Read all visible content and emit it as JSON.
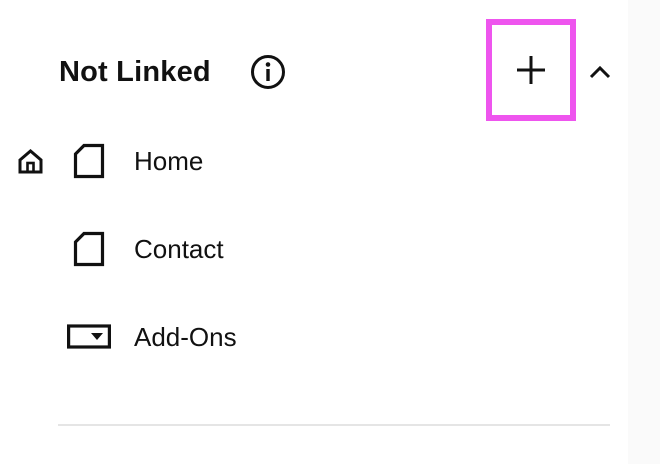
{
  "section": {
    "title": "Not Linked",
    "info_icon": "info-circle-icon",
    "add_icon": "plus-icon",
    "collapse_icon": "chevron-up-icon"
  },
  "pages": [
    {
      "label": "Home",
      "icon": "page-icon",
      "is_homepage": true,
      "homepage_icon": "home-icon"
    },
    {
      "label": "Contact",
      "icon": "page-icon",
      "is_homepage": false
    },
    {
      "label": "Add-Ons",
      "icon": "dropdown-box-icon",
      "is_homepage": false
    }
  ],
  "colors": {
    "highlight": "#ee55ee",
    "text": "#111111",
    "divider": "#e5e5e5"
  }
}
